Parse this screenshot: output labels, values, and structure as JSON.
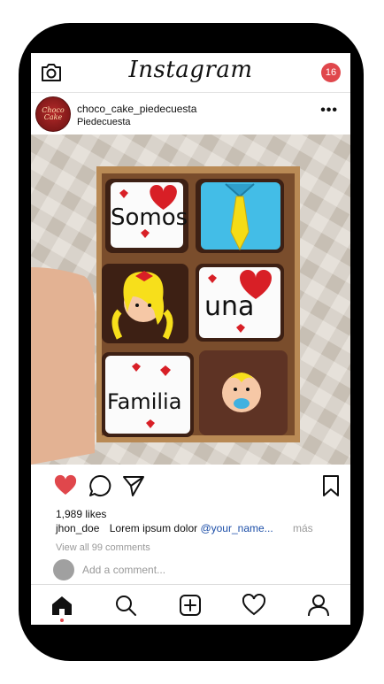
{
  "app": {
    "title": "Instagram",
    "notification_count": "16"
  },
  "post": {
    "username": "choco_cake_piedecuesta",
    "location": "Piedecuesta",
    "avatar_text": "Choco Cake",
    "likes": "1,989 likes",
    "caption_user": "jhon_doe",
    "caption_text": "Lorem ipsum dolor",
    "caption_handle": "@your_name...",
    "caption_more": "más",
    "view_comments": "View all 99 comments",
    "add_comment_placeholder": "Add a comment..."
  },
  "photo": {
    "brownie_texts": [
      "Somos",
      "una",
      "Familia"
    ]
  },
  "colors": {
    "accent": "#e0474c",
    "link": "#1d4fa8",
    "muted": "#999999"
  },
  "icons": {
    "top": [
      "camera-icon",
      "notification-badge"
    ],
    "actions": [
      "heart-filled-icon",
      "comment-icon",
      "share-icon",
      "bookmark-icon"
    ],
    "nav": [
      "home-icon",
      "search-icon",
      "add-icon",
      "heart-icon",
      "profile-icon"
    ]
  }
}
